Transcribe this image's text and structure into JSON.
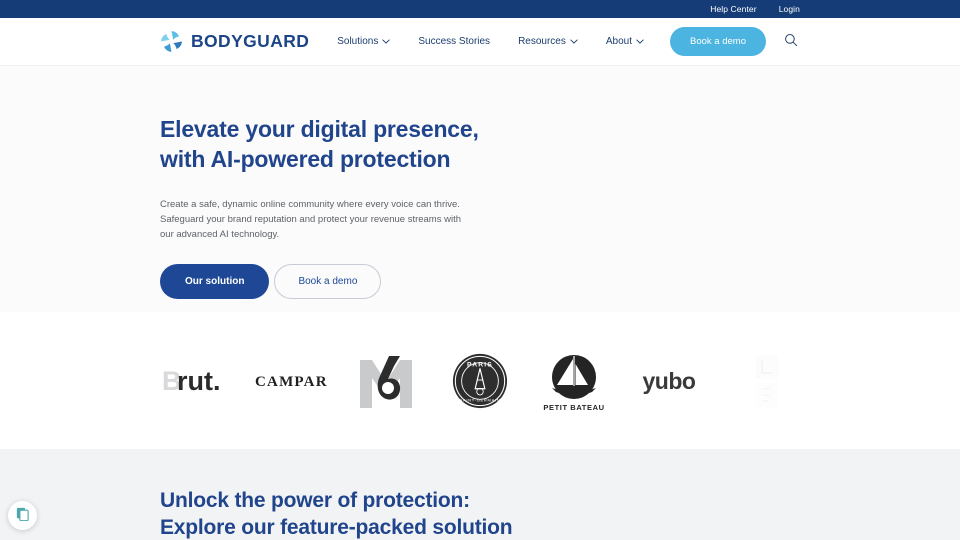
{
  "topbar": {
    "links": [
      {
        "label": "Help Center",
        "name": "help-center-link"
      },
      {
        "label": "Login",
        "name": "login-link"
      }
    ]
  },
  "header": {
    "brand": "BODYGUARD",
    "nav": [
      {
        "label": "Solutions",
        "has_chevron": true
      },
      {
        "label": "Success Stories",
        "has_chevron": false
      },
      {
        "label": "Resources",
        "has_chevron": true
      },
      {
        "label": "About",
        "has_chevron": true
      }
    ],
    "demo_button": "Book a demo",
    "search_icon": "search-icon"
  },
  "hero": {
    "title": "Elevate your digital presence,\nwith AI-powered protection",
    "subtitle": "Create a safe, dynamic online community where every voice can thrive. Safeguard your brand reputation and protect your revenue streams with our advanced AI technology.",
    "primary_button": "Our solution",
    "secondary_button": "Book a demo"
  },
  "logos": {
    "items": [
      {
        "name": "brut",
        "label": "Brut."
      },
      {
        "name": "campari",
        "label": "CAMPARI"
      },
      {
        "name": "m6",
        "label": "M6"
      },
      {
        "name": "paris-saint-germain",
        "label": "PARIS SAINT-GERMAIN"
      },
      {
        "name": "petit-bateau",
        "label": "PETIT BATEAU"
      },
      {
        "name": "yubo",
        "label": "yubo"
      },
      {
        "name": "partial-logo",
        "label": ""
      }
    ]
  },
  "bottom": {
    "title": "Unlock the power of protection:\nExplore our feature-packed solution"
  },
  "widget": {
    "icon": "document-copy-icon"
  },
  "colors": {
    "topbar_navy": "#153c77",
    "brand_navy": "#1b4586",
    "heading_blue": "#21458c",
    "cta_blue": "#1e4896",
    "demo_cyan": "#4cb4e0",
    "hero_bg": "#fbfbfc",
    "bottom_bg": "#f2f3f5",
    "widget_teal": "#4aa8ac"
  }
}
